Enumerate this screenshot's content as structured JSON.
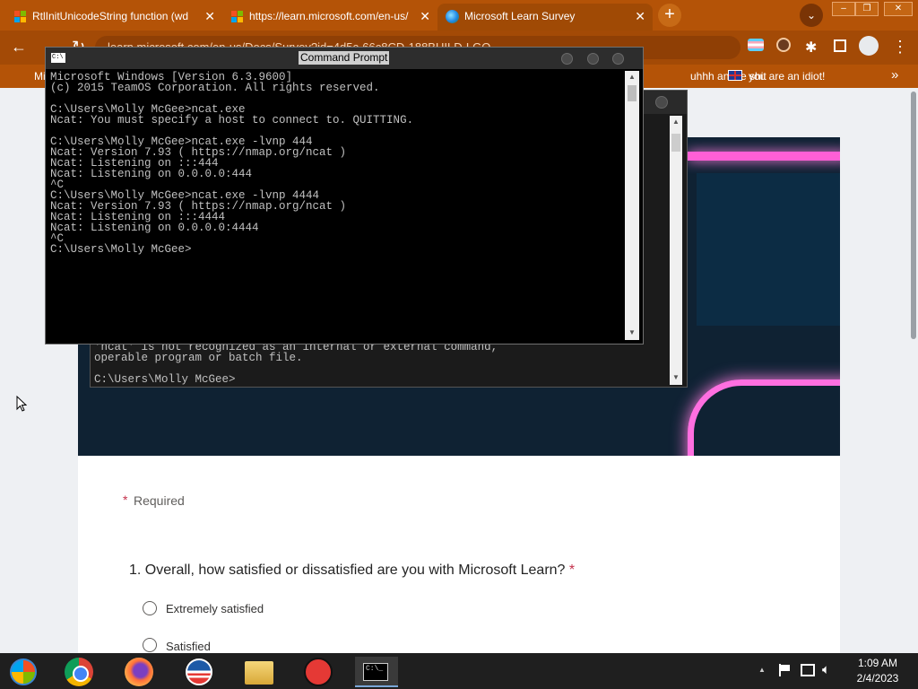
{
  "browser": {
    "tabs": [
      {
        "label": "RtlInitUnicodeString function (wd",
        "close": "✕"
      },
      {
        "label": "https://learn.microsoft.com/en-us/",
        "close": "✕"
      },
      {
        "label": "Microsoft Learn  Survey",
        "close": "✕"
      }
    ],
    "new_tab": "+",
    "tab_search": "⌄",
    "window_controls": [
      "–",
      "❐",
      "✕"
    ],
    "address": "learn.microsoft.com/en-us/Docs/Survey?id=4d5c-66c8CD-188BUILD-LGO...",
    "bookmarks_partial_left": "Mi",
    "bookmarks": [
      {
        "label": "uhhh anime shit"
      },
      {
        "label": "you are an idiot!"
      }
    ],
    "bookmarks_more": "»",
    "accent": "#b45307"
  },
  "console_back": {
    "lines": "'ncat' is not recognized as an internal or external command,\noperable program or batch file.\n\nC:\\Users\\Molly McGee>"
  },
  "console_front": {
    "title": "Command Prompt",
    "icon_text": "C:\\",
    "text": "Microsoft Windows [Version 6.3.9600]\n(c) 2015 TeamOS Corporation. All rights reserved.\n\nC:\\Users\\Molly McGee>ncat.exe\nNcat: You must specify a host to connect to. QUITTING.\n\nC:\\Users\\Molly McGee>ncat.exe -lvnp 444\nNcat: Version 7.93 ( https://nmap.org/ncat )\nNcat: Listening on :::444\nNcat: Listening on 0.0.0.0:444\n^C\nC:\\Users\\Molly McGee>ncat.exe -lvnp 4444\nNcat: Version 7.93 ( https://nmap.org/ncat )\nNcat: Listening on :::4444\nNcat: Listening on 0.0.0.0:4444\n^C\nC:\\Users\\Molly McGee>"
  },
  "survey": {
    "required_star": "*",
    "required_label": "Required",
    "question": "1. Overall, how satisfied or dissatisfied are you with Microsoft Learn?",
    "question_star": "*",
    "options": [
      "Extremely satisfied",
      "Satisfied"
    ]
  },
  "taskbar": {
    "time": "1:09 AM",
    "date": "2/4/2023",
    "tray_chevron": "▲",
    "console_icon_text": "C:\\_"
  }
}
